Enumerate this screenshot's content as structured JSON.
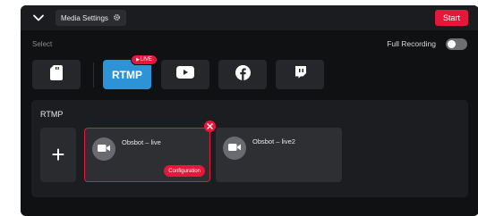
{
  "header": {
    "media_settings_label": "Media Settings",
    "start_label": "Start"
  },
  "select_label": "Select",
  "full_recording": {
    "label": "Full Recording",
    "enabled": false
  },
  "platforms": [
    {
      "name": "sd-card-icon"
    },
    {
      "name": "rtmp",
      "label": "RTMP",
      "active": true,
      "badge": "LIVE"
    },
    {
      "name": "youtube-icon"
    },
    {
      "name": "facebook-icon"
    },
    {
      "name": "twitch-icon"
    }
  ],
  "rtmp_section": {
    "title": "RTMP",
    "add_label": "+",
    "streams": [
      {
        "name": "Obsbot – live",
        "selected": true,
        "config_label": "Configuration"
      },
      {
        "name": "Obsbot – live2",
        "selected": false
      }
    ]
  },
  "colors": {
    "accent_red": "#e5183c",
    "rtmp_blue": "#2c93d6",
    "panel_bg": "#101113"
  }
}
